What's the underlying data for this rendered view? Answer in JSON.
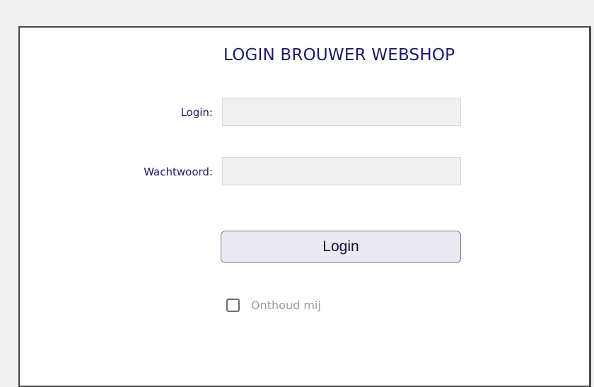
{
  "login_form": {
    "title": "LOGIN BROUWER WEBSHOP",
    "login_label": "Login:",
    "login_value": "",
    "password_label": "Wachtwoord:",
    "password_value": "",
    "submit_label": "Login",
    "remember_label": "Onthoud mij",
    "remember_checked": false
  },
  "colors": {
    "background": "#f0f0f0",
    "panel": "#ffffff",
    "title_text": "#1c1c6b",
    "label_text": "#1c1c6b",
    "field_background": "#f0f0f0",
    "button_background": "#ebeaf2",
    "muted_text": "#9a9a9a"
  }
}
